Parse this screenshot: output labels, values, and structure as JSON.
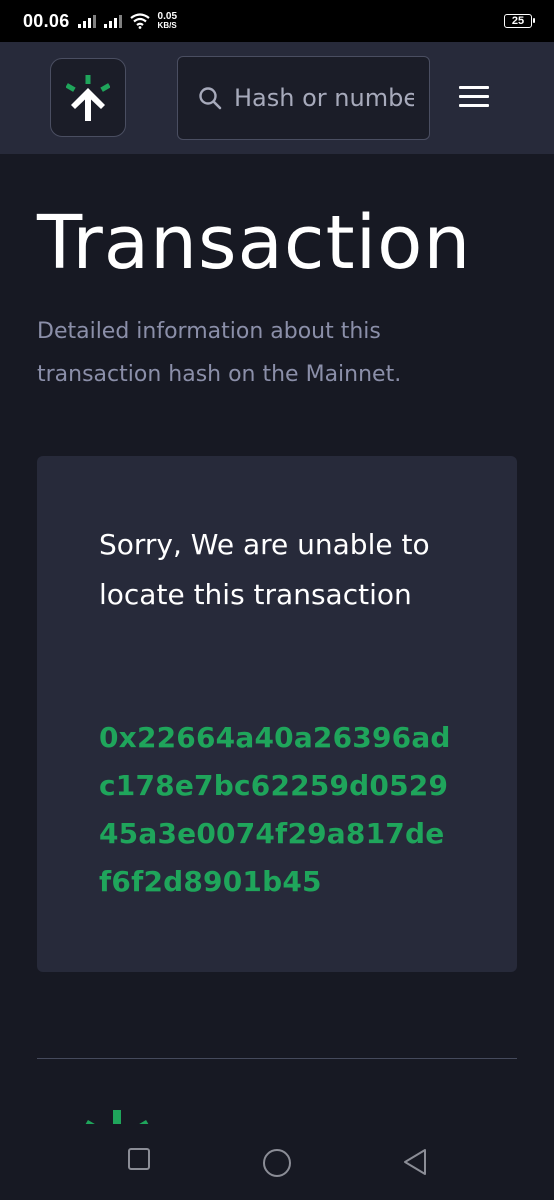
{
  "status_bar": {
    "time": "00.06",
    "net_speed_value": "0.05",
    "net_speed_unit": "KB/S",
    "battery": "25"
  },
  "header": {
    "logo_icon": "linea-logo-icon",
    "search_placeholder": "Hash or number",
    "menu_icon": "hamburger-menu-icon"
  },
  "main": {
    "title": "Transaction",
    "description": "Detailed information about this transaction hash on the Mainnet.",
    "error_message": "Sorry, We are unable to locate this transaction",
    "tx_hash": "0x22664a40a26396adc178e7bc62259d052945a3e0074f29a817def6f2d8901b45"
  },
  "nav_bar": {
    "recents_icon": "square-icon",
    "home_icon": "circle-icon",
    "back_icon": "triangle-back-icon"
  },
  "colors": {
    "background": "#171923",
    "header_bg": "#272a3a",
    "card_bg": "#272a3a",
    "accent_green": "#1fa55b",
    "muted_text": "#8b8fa9"
  }
}
